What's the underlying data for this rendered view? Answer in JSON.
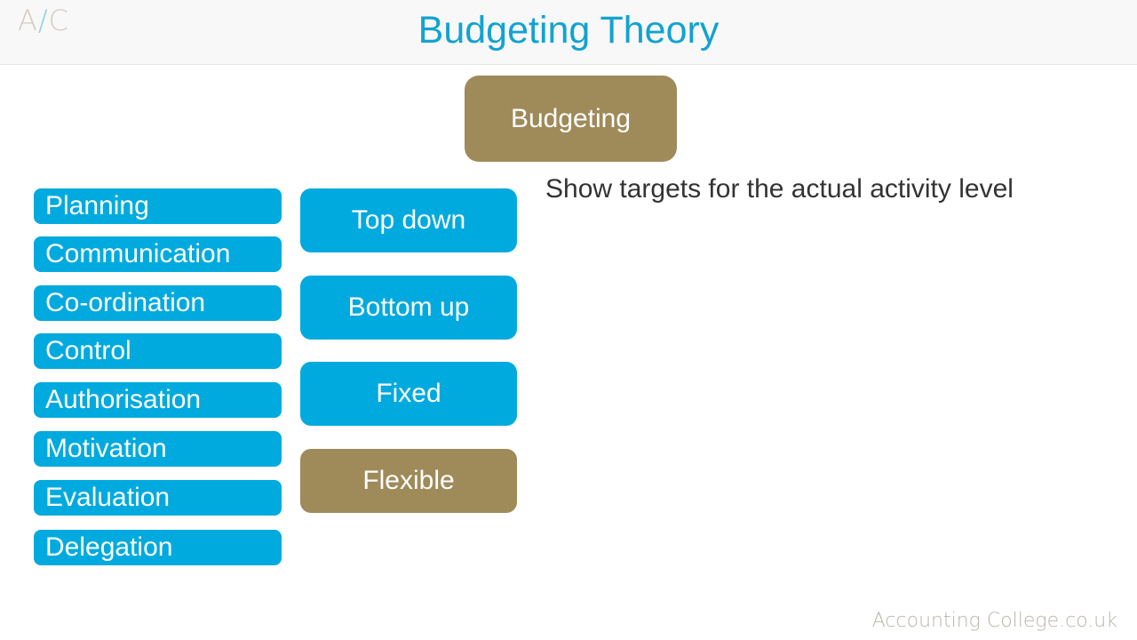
{
  "header": {
    "logo": {
      "left": "A",
      "slash": "/",
      "right": "C"
    },
    "title": "Budgeting Theory"
  },
  "main_box": {
    "label": "Budgeting"
  },
  "purposes": [
    {
      "label": "Planning"
    },
    {
      "label": "Communication"
    },
    {
      "label": "Co-ordination"
    },
    {
      "label": "Control"
    },
    {
      "label": "Authorisation"
    },
    {
      "label": "Motivation"
    },
    {
      "label": "Evaluation"
    },
    {
      "label": "Delegation"
    }
  ],
  "budget_types": [
    {
      "label": "Top down",
      "highlighted": false
    },
    {
      "label": "Bottom up",
      "highlighted": false
    },
    {
      "label": "Fixed",
      "highlighted": false
    },
    {
      "label": "Flexible",
      "highlighted": true
    }
  ],
  "description": "Show targets for the actual activity level",
  "footer": {
    "brand": "Accounting College.co.uk"
  },
  "colors": {
    "blue": "#00aade",
    "gold": "#9f8a5a",
    "title": "#12a3cf"
  }
}
